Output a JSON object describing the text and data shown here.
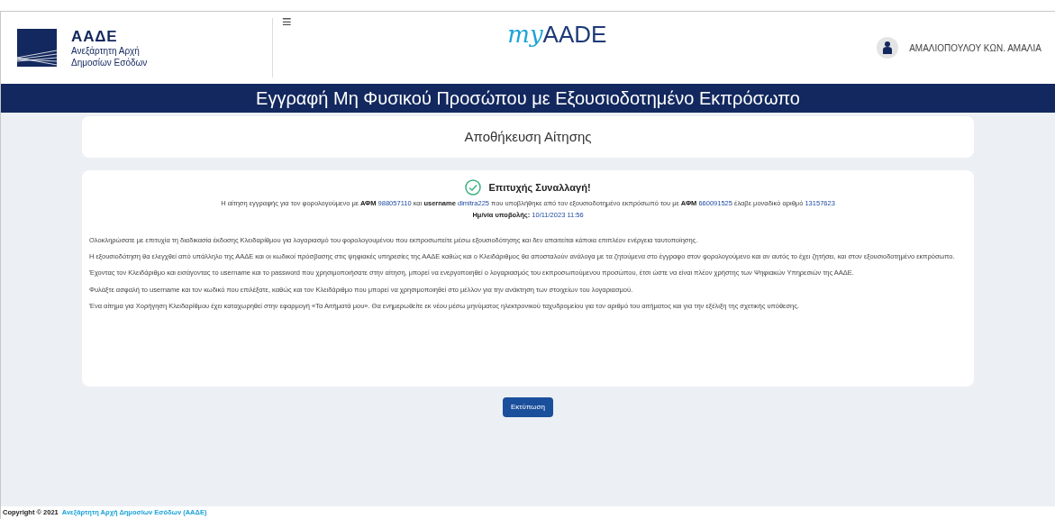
{
  "header": {
    "org_abbr": "ΑΑΔΕ",
    "org_name_line1": "Ανεξάρτητη Αρχή",
    "org_name_line2": "Δημοσίων Εσόδων",
    "menu_glyph": "≡",
    "brand_prefix": "my",
    "brand_suffix": "AADE",
    "user_name": "ΑΜΑΛΙΟΠΟΥΛΟΥ ΚΩΝ. ΑΜΑΛΙΑ"
  },
  "title_bar": "Εγγραφή Μη Φυσικού Προσώπου με Εξουσιοδοτημένο Εκπρόσωπο",
  "section_title": "Αποθήκευση Αίτησης",
  "result": {
    "heading": "Επιτυχής Συναλλαγή!",
    "summary_lines": [
      [
        {
          "kind": "plain",
          "text": "Η αίτηση εγγραφής για τον φορολογούμενο με"
        },
        {
          "kind": "label",
          "text": "ΑΦΜ"
        },
        {
          "kind": "value",
          "text": "988057110"
        },
        {
          "kind": "plain",
          "text": "και"
        },
        {
          "kind": "label",
          "text": "username"
        },
        {
          "kind": "value",
          "text": "dimitra225"
        },
        {
          "kind": "plain",
          "text": "που υποβλήθηκε από τον εξουσιοδοτημένο εκπρόσωπό του με"
        },
        {
          "kind": "label",
          "text": "ΑΦΜ"
        },
        {
          "kind": "value",
          "text": "660091525"
        },
        {
          "kind": "plain",
          "text": "έλαβε μοναδικό αριθμό"
        },
        {
          "kind": "value",
          "text": "13157623"
        }
      ],
      [
        {
          "kind": "label",
          "text": "Ημ/νία υποβολής:"
        },
        {
          "kind": "value",
          "text": "10/11/2023 11:56"
        }
      ]
    ],
    "paragraphs": [
      "Ολοκληρώσατε με επιτυχία τη διαδικασία έκδοσης Κλειδαρίθμου για λογαριασμό του φορολογουμένου που εκπροσωπείτε μέσω εξουσιοδότησης και δεν απαιτείται κάποια επιπλέον ενέργεια ταυτοποίησης.",
      "Η εξουσιοδότηση θα ελεγχθεί από υπάλληλο της ΑΑΔΕ και οι κωδικοί πρόσβασης στις ψηφιακές υπηρεσίες της ΑΑΔΕ καθώς και ο Κλειδάριθμος θα αποσταλούν ανάλογα με τα ζητούμενα στο έγγραφο στον φορολογούμενο και αν αυτός το έχει ζητήσει, και στον εξουσιοδοτημένο εκπρόσωπο.",
      "Έχοντας τον Κλειδάριθμο και εισάγοντας το username και το password που χρησιμοποιήσατε στην αίτηση, μπορεί να ενεργοποιηθεί ο λογαριασμός του εκπροσωπούμενου προσώπου, έτσι ώστε να είναι πλέον χρήστης των Ψηφιακών Υπηρεσιών της ΑΑΔΕ.",
      "Φυλάξτε ασφαλή το username και τον κωδικό που επιλέξατε, καθώς και τον Κλειδάριθμο που μπορεί να χρησιμοποιηθεί στο μέλλον για την ανάκτηση των στοιχείων του λογαριασμού.",
      "Ένα αίτημα για Χορήγηση Κλειδαρίθμου έχει καταχωρηθεί στην εφαρμογή «Τα Αιτήματά μου». Θα ενημερωθείτε εκ νέου μέσω μηνύματος ηλεκτρονικού ταχυδρομείου για τον αριθμό του αιτήματος και για την εξέλιξη της σχετικής υπόθεσης."
    ]
  },
  "print_button": "Εκτύπωση",
  "footer": {
    "copyright": "Copyright © 2021",
    "link": "Ανεξάρτητη Αρχή Δημοσίων Εσόδων (ΑΑΔΕ)"
  }
}
